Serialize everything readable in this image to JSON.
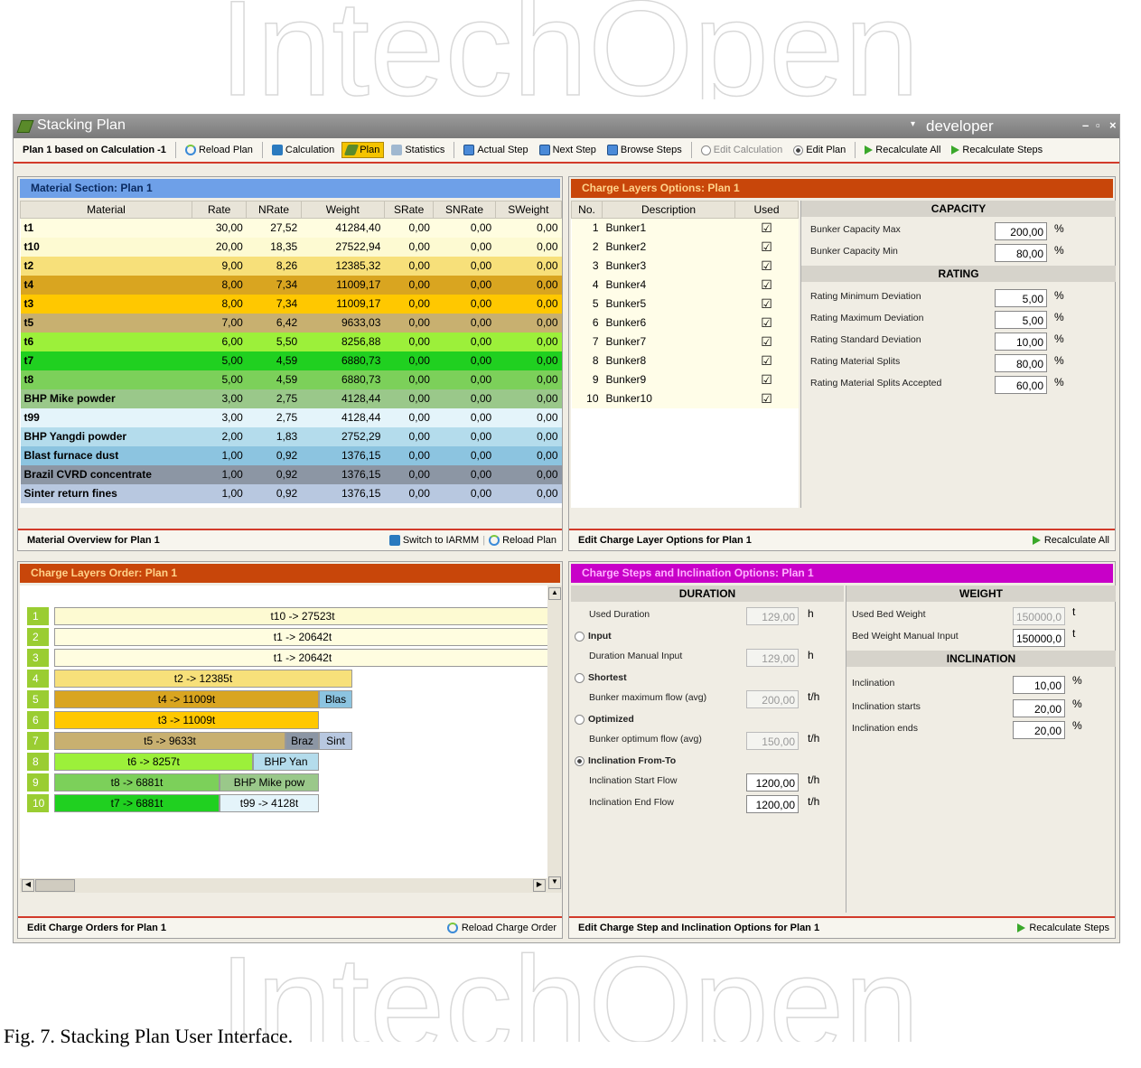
{
  "window": {
    "title": "Stacking Plan",
    "user": "developer",
    "controls": [
      "–",
      "▫",
      "×"
    ]
  },
  "toolbar": {
    "plan_label": "Plan 1 based on Calculation -1",
    "reload_plan": "Reload Plan",
    "calculation": "Calculation",
    "plan": "Plan",
    "statistics": "Statistics",
    "actual_step": "Actual Step",
    "next_step": "Next Step",
    "browse_steps": "Browse Steps",
    "edit_calculation": "Edit Calculation",
    "edit_plan": "Edit Plan",
    "recalculate_all": "Recalculate All",
    "recalculate_steps": "Recalculate Steps"
  },
  "material_section": {
    "title": "Material Section: Plan 1",
    "columns": [
      "Material",
      "Rate",
      "NRate",
      "Weight",
      "SRate",
      "SNRate",
      "SWeight"
    ],
    "rows": [
      {
        "name": "t1",
        "rate": "30,00",
        "nrate": "27,52",
        "weight": "41284,40",
        "srate": "0,00",
        "snrate": "0,00",
        "sweight": "0,00",
        "color": "#fffde0"
      },
      {
        "name": "t10",
        "rate": "20,00",
        "nrate": "18,35",
        "weight": "27522,94",
        "srate": "0,00",
        "snrate": "0,00",
        "sweight": "0,00",
        "color": "#fdfad2"
      },
      {
        "name": "t2",
        "rate": "9,00",
        "nrate": "8,26",
        "weight": "12385,32",
        "srate": "0,00",
        "snrate": "0,00",
        "sweight": "0,00",
        "color": "#f7e07a"
      },
      {
        "name": "t4",
        "rate": "8,00",
        "nrate": "7,34",
        "weight": "11009,17",
        "srate": "0,00",
        "snrate": "0,00",
        "sweight": "0,00",
        "color": "#d9a520"
      },
      {
        "name": "t3",
        "rate": "8,00",
        "nrate": "7,34",
        "weight": "11009,17",
        "srate": "0,00",
        "snrate": "0,00",
        "sweight": "0,00",
        "color": "#ffc800"
      },
      {
        "name": "t5",
        "rate": "7,00",
        "nrate": "6,42",
        "weight": "9633,03",
        "srate": "0,00",
        "snrate": "0,00",
        "sweight": "0,00",
        "color": "#c8b070"
      },
      {
        "name": "t6",
        "rate": "6,00",
        "nrate": "5,50",
        "weight": "8256,88",
        "srate": "0,00",
        "snrate": "0,00",
        "sweight": "0,00",
        "color": "#9cf03a"
      },
      {
        "name": "t7",
        "rate": "5,00",
        "nrate": "4,59",
        "weight": "6880,73",
        "srate": "0,00",
        "snrate": "0,00",
        "sweight": "0,00",
        "color": "#20d020"
      },
      {
        "name": "t8",
        "rate": "5,00",
        "nrate": "4,59",
        "weight": "6880,73",
        "srate": "0,00",
        "snrate": "0,00",
        "sweight": "0,00",
        "color": "#7cd05a"
      },
      {
        "name": "BHP Mike powder",
        "rate": "3,00",
        "nrate": "2,75",
        "weight": "4128,44",
        "srate": "0,00",
        "snrate": "0,00",
        "sweight": "0,00",
        "color": "#9ac88a"
      },
      {
        "name": "t99",
        "rate": "3,00",
        "nrate": "2,75",
        "weight": "4128,44",
        "srate": "0,00",
        "snrate": "0,00",
        "sweight": "0,00",
        "color": "#e4f4fa"
      },
      {
        "name": "BHP Yangdi powder",
        "rate": "2,00",
        "nrate": "1,83",
        "weight": "2752,29",
        "srate": "0,00",
        "snrate": "0,00",
        "sweight": "0,00",
        "color": "#b4dcec"
      },
      {
        "name": "Blast furnace dust",
        "rate": "1,00",
        "nrate": "0,92",
        "weight": "1376,15",
        "srate": "0,00",
        "snrate": "0,00",
        "sweight": "0,00",
        "color": "#8cc4e0"
      },
      {
        "name": "Brazil CVRD concentrate",
        "rate": "1,00",
        "nrate": "0,92",
        "weight": "1376,15",
        "srate": "0,00",
        "snrate": "0,00",
        "sweight": "0,00",
        "color": "#8c96a4"
      },
      {
        "name": "Sinter return fines",
        "rate": "1,00",
        "nrate": "0,92",
        "weight": "1376,15",
        "srate": "0,00",
        "snrate": "0,00",
        "sweight": "0,00",
        "color": "#b8c8e0"
      }
    ],
    "footer": "Material Overview for Plan 1",
    "switch": "Switch to IARMM",
    "reload": "Reload Plan"
  },
  "charge_layers_options": {
    "title": "Charge Layers Options: Plan 1",
    "columns": [
      "No.",
      "Description",
      "Used"
    ],
    "bunkers": [
      {
        "no": "1",
        "desc": "Bunker1"
      },
      {
        "no": "2",
        "desc": "Bunker2"
      },
      {
        "no": "3",
        "desc": "Bunker3"
      },
      {
        "no": "4",
        "desc": "Bunker4"
      },
      {
        "no": "5",
        "desc": "Bunker5"
      },
      {
        "no": "6",
        "desc": "Bunker6"
      },
      {
        "no": "7",
        "desc": "Bunker7"
      },
      {
        "no": "8",
        "desc": "Bunker8"
      },
      {
        "no": "9",
        "desc": "Bunker9"
      },
      {
        "no": "10",
        "desc": "Bunker10"
      }
    ],
    "capacity_header": "CAPACITY",
    "bunker_capacity_max_label": "Bunker Capacity Max",
    "bunker_capacity_max": "200,00",
    "bunker_capacity_min_label": "Bunker Capacity Min",
    "bunker_capacity_min": "80,00",
    "rating_header": "RATING",
    "rating_min_dev_label": "Rating Minimum Deviation",
    "rating_min_dev": "5,00",
    "rating_max_dev_label": "Rating Maximum Deviation",
    "rating_max_dev": "5,00",
    "rating_std_dev_label": "Rating Standard Deviation",
    "rating_std_dev": "10,00",
    "rating_splits_label": "Rating Material Splits",
    "rating_splits": "80,00",
    "rating_splits_acc_label": "Rating Material Splits Accepted",
    "rating_splits_acc": "60,00",
    "percent": "%",
    "footer": "Edit Charge Layer Options for Plan 1",
    "recalc": "Recalculate All"
  },
  "charge_layers_order": {
    "title": "Charge Layers Order: Plan 1",
    "rows": [
      {
        "n": "1",
        "segs": [
          {
            "t": "t10 -> 27523t",
            "c": "#fdfad2",
            "w": 550
          }
        ]
      },
      {
        "n": "2",
        "segs": [
          {
            "t": "t1 -> 20642t",
            "c": "#fffde0",
            "w": 550
          }
        ]
      },
      {
        "n": "3",
        "segs": [
          {
            "t": "t1 -> 20642t",
            "c": "#fffde0",
            "w": 550
          }
        ]
      },
      {
        "n": "4",
        "segs": [
          {
            "t": "t2 -> 12385t",
            "c": "#f7e07a",
            "w": 330
          }
        ]
      },
      {
        "n": "5",
        "segs": [
          {
            "t": "t4 -> 11009t",
            "c": "#d9a520",
            "w": 293
          },
          {
            "t": "Blas",
            "c": "#8cc4e0",
            "w": 37
          }
        ]
      },
      {
        "n": "6",
        "segs": [
          {
            "t": "t3 -> 11009t",
            "c": "#ffc800",
            "w": 293
          }
        ]
      },
      {
        "n": "7",
        "segs": [
          {
            "t": "t5 -> 9633t",
            "c": "#c8b070",
            "w": 256
          },
          {
            "t": "Braz",
            "c": "#8c96a4",
            "w": 37
          },
          {
            "t": "Sint",
            "c": "#b8c8e0",
            "w": 37
          }
        ]
      },
      {
        "n": "8",
        "segs": [
          {
            "t": "t6 -> 8257t",
            "c": "#9cf03a",
            "w": 220
          },
          {
            "t": "BHP Yan",
            "c": "#b4dcec",
            "w": 73
          }
        ]
      },
      {
        "n": "9",
        "segs": [
          {
            "t": "t8 -> 6881t",
            "c": "#7cd05a",
            "w": 183
          },
          {
            "t": "BHP Mike pow",
            "c": "#9ac88a",
            "w": 110
          }
        ]
      },
      {
        "n": "10",
        "segs": [
          {
            "t": "t7 -> 6881t",
            "c": "#20d020",
            "w": 183
          },
          {
            "t": "t99 -> 4128t",
            "c": "#e4f4fa",
            "w": 110
          }
        ]
      }
    ],
    "footer": "Edit Charge Orders for Plan 1",
    "reload": "Reload Charge Order"
  },
  "charge_steps": {
    "title": "Charge Steps and Inclination Options: Plan 1",
    "duration_header": "DURATION",
    "used_duration_label": "Used Duration",
    "used_duration": "129,00",
    "h": "h",
    "input_label": "Input",
    "duration_manual_label": "Duration Manual Input",
    "duration_manual": "129,00",
    "shortest_label": "Shortest",
    "bunker_max_flow_label": "Bunker maximum flow (avg)",
    "bunker_max_flow": "200,00",
    "th": "t/h",
    "optimized_label": "Optimized",
    "bunker_opt_flow_label": "Bunker optimum flow (avg)",
    "bunker_opt_flow": "150,00",
    "incl_fromto_label": "Inclination From-To",
    "incl_start_flow_label": "Inclination Start Flow",
    "incl_start_flow": "1200,00",
    "incl_end_flow_label": "Inclination End Flow",
    "incl_end_flow": "1200,00",
    "weight_header": "WEIGHT",
    "used_bed_weight_label": "Used Bed Weight",
    "used_bed_weight": "150000,0",
    "t": "t",
    "bed_weight_manual_label": "Bed Weight Manual Input",
    "bed_weight_manual": "150000,0",
    "inclination_header": "INCLINATION",
    "inclination_label": "Inclination",
    "inclination": "10,00",
    "incl_starts_label": "Inclination starts",
    "incl_starts": "20,00",
    "incl_ends_label": "Inclination ends",
    "incl_ends": "20,00",
    "percent": "%",
    "footer": "Edit Charge Step and Inclination Options for Plan 1",
    "recalc": "Recalculate Steps"
  },
  "watermark": {
    "text_top": "IntechOpen",
    "text_bottom": "IntechOpen"
  },
  "caption": "Fig. 7.  Stacking Plan User Interface."
}
